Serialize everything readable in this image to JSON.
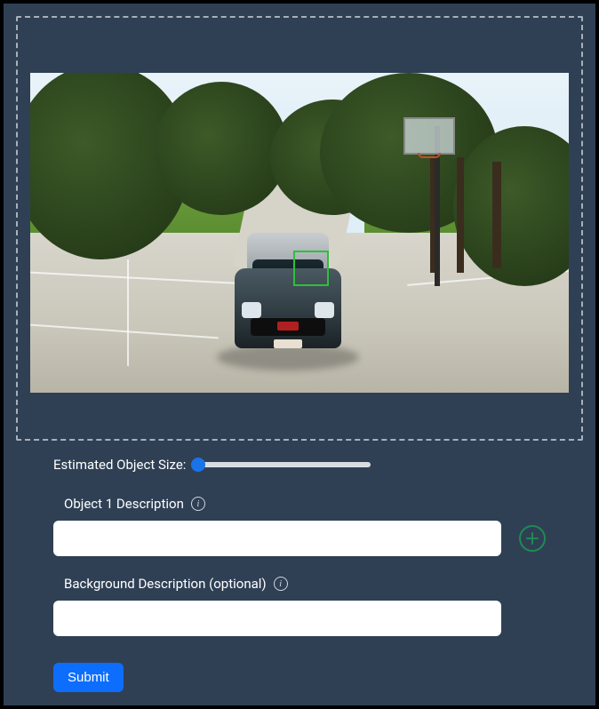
{
  "image_panel": {
    "selection_box_label": "object-selection"
  },
  "slider": {
    "label": "Estimated Object Size:",
    "value": 0,
    "min": 0,
    "max": 100
  },
  "fields": {
    "object1": {
      "label": "Object 1 Description",
      "value": "",
      "placeholder": ""
    },
    "background": {
      "label": "Background Description (optional)",
      "value": "",
      "placeholder": ""
    }
  },
  "buttons": {
    "add_object_title": "Add object",
    "submit_label": "Submit"
  },
  "icons": {
    "info": "i",
    "plus": "+"
  }
}
